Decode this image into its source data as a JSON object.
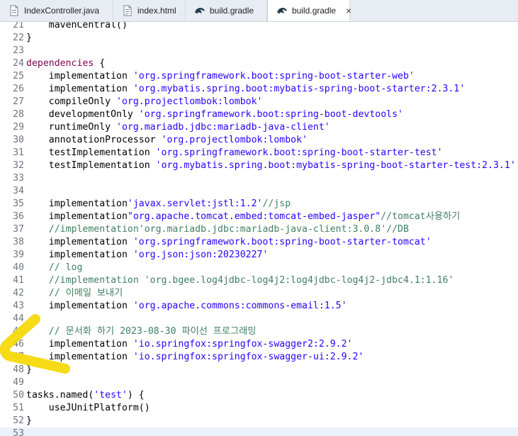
{
  "tabs": [
    {
      "label": "IndexController.java",
      "icon": "java-file-icon",
      "active": false
    },
    {
      "label": "index.html",
      "icon": "html-file-icon",
      "active": false
    },
    {
      "label": "build.gradle",
      "icon": "gradle-elephant-icon",
      "active": false
    },
    {
      "label": "build.gradle",
      "icon": "gradle-elephant-icon",
      "active": true,
      "close": "×"
    }
  ],
  "lines": [
    {
      "n": "21",
      "t": [
        [
          "",
          "    mavenCentral()"
        ]
      ]
    },
    {
      "n": "22",
      "t": [
        [
          "",
          "}"
        ]
      ]
    },
    {
      "n": "23",
      "t": []
    },
    {
      "n": "24",
      "t": [
        [
          "kw",
          "dependencies"
        ],
        [
          "",
          " {"
        ]
      ]
    },
    {
      "n": "25",
      "t": [
        [
          "",
          "    implementation "
        ],
        [
          "str",
          "'org.springframework.boot:spring-boot-starter-web'"
        ]
      ]
    },
    {
      "n": "26",
      "t": [
        [
          "",
          "    implementation "
        ],
        [
          "str",
          "'org.mybatis.spring.boot:mybatis-spring-boot-starter:2.3.1'"
        ]
      ]
    },
    {
      "n": "27",
      "t": [
        [
          "",
          "    compileOnly "
        ],
        [
          "str",
          "'org.projectlombok:lombok'"
        ]
      ]
    },
    {
      "n": "28",
      "t": [
        [
          "",
          "    developmentOnly "
        ],
        [
          "str",
          "'org.springframework.boot:spring-boot-devtools'"
        ]
      ]
    },
    {
      "n": "29",
      "t": [
        [
          "",
          "    runtimeOnly "
        ],
        [
          "str",
          "'org.mariadb.jdbc:mariadb-java-client'"
        ]
      ]
    },
    {
      "n": "30",
      "t": [
        [
          "",
          "    annotationProcessor "
        ],
        [
          "str",
          "'org.projectlombok:lombok'"
        ]
      ]
    },
    {
      "n": "31",
      "t": [
        [
          "",
          "    testImplementation "
        ],
        [
          "str",
          "'org.springframework.boot:spring-boot-starter-test'"
        ]
      ]
    },
    {
      "n": "32",
      "t": [
        [
          "",
          "    testImplementation "
        ],
        [
          "str",
          "'org.mybatis.spring.boot:mybatis-spring-boot-starter-test:2.3.1'"
        ]
      ]
    },
    {
      "n": "33",
      "t": []
    },
    {
      "n": "34",
      "t": []
    },
    {
      "n": "35",
      "t": [
        [
          "",
          "    implementation"
        ],
        [
          "str",
          "'javax.servlet:jstl:1.2'"
        ],
        [
          "cmt",
          "//jsp"
        ]
      ]
    },
    {
      "n": "36",
      "t": [
        [
          "",
          "    implementation"
        ],
        [
          "str",
          "\"org.apache.tomcat.embed:tomcat-embed-jasper\""
        ],
        [
          "cmt",
          "//tomcat사용하기"
        ]
      ]
    },
    {
      "n": "37",
      "t": [
        [
          "cmt",
          "    //implementation'org.mariadb.jdbc:mariadb-java-client:3.0.8'//DB"
        ]
      ]
    },
    {
      "n": "38",
      "t": [
        [
          "",
          "    implementation "
        ],
        [
          "str",
          "'org.springframework.boot:spring-boot-starter-tomcat'"
        ]
      ]
    },
    {
      "n": "39",
      "t": [
        [
          "",
          "    implementation "
        ],
        [
          "str",
          "'org.json:json:20230227'"
        ]
      ]
    },
    {
      "n": "40",
      "t": [
        [
          "cmt",
          "    // log"
        ]
      ]
    },
    {
      "n": "41",
      "t": [
        [
          "cmt",
          "    //implementation 'org.bgee.log4jdbc-log4j2:log4jdbc-log4j2-jdbc4.1:1.16'"
        ]
      ]
    },
    {
      "n": "42",
      "t": [
        [
          "cmt",
          "    // 이메일 보내기"
        ]
      ]
    },
    {
      "n": "43",
      "t": [
        [
          "",
          "    implementation "
        ],
        [
          "str",
          "'org.apache.commons:commons-email:1.5'"
        ]
      ]
    },
    {
      "n": "44",
      "t": []
    },
    {
      "n": "45",
      "t": [
        [
          "cmt",
          "    // 문서화 하기 2023-08-30 파이선 프로그래밍"
        ]
      ]
    },
    {
      "n": "46",
      "t": [
        [
          "",
          "    implementation "
        ],
        [
          "str",
          "'io.springfox:springfox-swagger2:2.9.2'"
        ]
      ]
    },
    {
      "n": "47",
      "t": [
        [
          "",
          "    implementation "
        ],
        [
          "str",
          "'io.springfox:springfox-swagger-ui:2.9.2'"
        ]
      ]
    },
    {
      "n": "48",
      "t": [
        [
          "",
          "}"
        ]
      ]
    },
    {
      "n": "49",
      "t": []
    },
    {
      "n": "50",
      "t": [
        [
          "",
          "tasks.named("
        ],
        [
          "str",
          "'test'"
        ],
        [
          "",
          ") {"
        ]
      ]
    },
    {
      "n": "51",
      "t": [
        [
          "",
          "    useJUnitPlatform()"
        ]
      ]
    },
    {
      "n": "52",
      "t": [
        [
          "",
          "}"
        ]
      ]
    },
    {
      "n": "53",
      "t": [],
      "current": true
    }
  ],
  "colors": {
    "keyword": "#7f0055",
    "string": "#2a00ff",
    "comment": "#3f7f5f",
    "highlighter": "#f5d90a",
    "tab_bar": "#e8edf3"
  }
}
